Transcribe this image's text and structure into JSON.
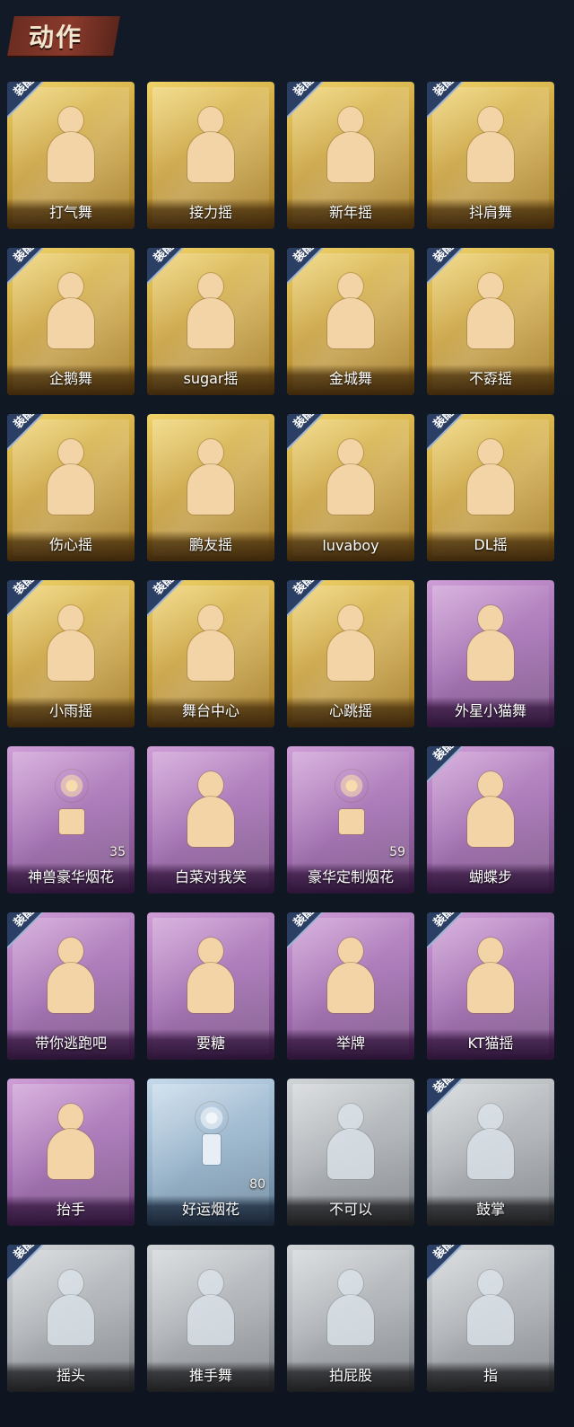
{
  "header": {
    "title": "动作"
  },
  "badge_label": "装配",
  "items": [
    {
      "label": "打气舞",
      "rarity": "gold",
      "equipped": true
    },
    {
      "label": "接力摇",
      "rarity": "gold",
      "equipped": false
    },
    {
      "label": "新年摇",
      "rarity": "gold",
      "equipped": true
    },
    {
      "label": "抖肩舞",
      "rarity": "gold",
      "equipped": true
    },
    {
      "label": "企鹅舞",
      "rarity": "gold",
      "equipped": true
    },
    {
      "label": "sugar摇",
      "rarity": "gold",
      "equipped": true
    },
    {
      "label": "金城舞",
      "rarity": "gold",
      "equipped": true
    },
    {
      "label": "不孬摇",
      "rarity": "gold",
      "equipped": true
    },
    {
      "label": "伤心摇",
      "rarity": "gold",
      "equipped": true
    },
    {
      "label": "鹏友摇",
      "rarity": "gold",
      "equipped": false
    },
    {
      "label": "luvaboy",
      "rarity": "gold",
      "equipped": true
    },
    {
      "label": "DL摇",
      "rarity": "gold",
      "equipped": true
    },
    {
      "label": "小雨摇",
      "rarity": "gold",
      "equipped": true
    },
    {
      "label": "舞台中心",
      "rarity": "gold",
      "equipped": true
    },
    {
      "label": "心跳摇",
      "rarity": "gold",
      "equipped": true
    },
    {
      "label": "外星小猫舞",
      "rarity": "purple",
      "equipped": false
    },
    {
      "label": "神兽豪华烟花",
      "rarity": "purple",
      "equipped": false,
      "count": "35",
      "type": "firework"
    },
    {
      "label": "白菜对我笑",
      "rarity": "purple",
      "equipped": false
    },
    {
      "label": "豪华定制烟花",
      "rarity": "purple",
      "equipped": false,
      "count": "59",
      "type": "firework"
    },
    {
      "label": "蝴蝶步",
      "rarity": "purple",
      "equipped": true
    },
    {
      "label": "带你逃跑吧",
      "rarity": "purple",
      "equipped": true
    },
    {
      "label": "要糖",
      "rarity": "purple",
      "equipped": false
    },
    {
      "label": "举牌",
      "rarity": "purple",
      "equipped": true
    },
    {
      "label": "KT猫摇",
      "rarity": "purple",
      "equipped": true
    },
    {
      "label": "抬手",
      "rarity": "purple",
      "equipped": false
    },
    {
      "label": "好运烟花",
      "rarity": "blue",
      "equipped": false,
      "count": "80",
      "type": "firecracker"
    },
    {
      "label": "不可以",
      "rarity": "gray",
      "equipped": false
    },
    {
      "label": "鼓掌",
      "rarity": "gray",
      "equipped": true
    },
    {
      "label": "摇头",
      "rarity": "gray",
      "equipped": true
    },
    {
      "label": "推手舞",
      "rarity": "gray",
      "equipped": false
    },
    {
      "label": "拍屁股",
      "rarity": "gray",
      "equipped": false
    },
    {
      "label": "指",
      "rarity": "gray",
      "equipped": true
    }
  ]
}
